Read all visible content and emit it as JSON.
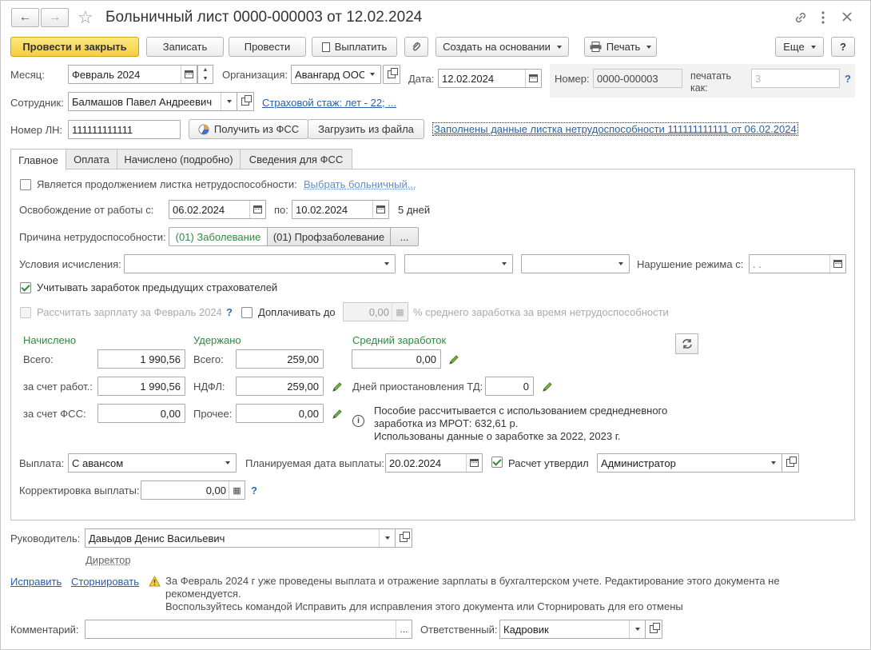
{
  "header": {
    "title": "Больничный лист 0000-000003 от 12.02.2024",
    "link_icon": "link-icon",
    "menu_icon": "more-vertical-icon",
    "close_icon": "close-icon"
  },
  "toolbar": {
    "post_close": "Провести и закрыть",
    "save": "Записать",
    "post": "Провести",
    "pay": "Выплатить",
    "create_based": "Создать на основании",
    "print": "Печать",
    "more": "Еще",
    "help": "?"
  },
  "fields": {
    "month_label": "Месяц:",
    "month": "Февраль 2024",
    "org_label": "Организация:",
    "org": "Авангард ООС",
    "date_label": "Дата:",
    "date": "12.02.2024",
    "number_label": "Номер:",
    "number": "0000-000003",
    "print_as_label_1": "печатать",
    "print_as_label_2": "как:",
    "print_as_placeholder": "3",
    "employee_label": "Сотрудник:",
    "employee": "Балмашов Павел Андреевич",
    "insurance_link": "Страховой стаж: лет - 22; ...",
    "ln_label": "Номер ЛН:",
    "ln": "111111111111",
    "get_fss": "Получить из ФСС",
    "load_file": "Загрузить из файла",
    "filled_link": "Заполнены данные листка нетрудоспособности 111111111111 от 06.02.2024"
  },
  "tabs": [
    "Главное",
    "Оплата",
    "Начислено (подробно)",
    "Сведения для ФСС"
  ],
  "main": {
    "continuation_label": "Является продолжением листка нетрудоспособности:",
    "choose_sick_link": "Выбрать больничный...",
    "release_label": "Освобождение от работы с:",
    "release_from": "06.02.2024",
    "release_to_label": "по:",
    "release_to": "10.02.2024",
    "days": "5 дней",
    "reason_label": "Причина нетрудоспособности:",
    "reason_1": "(01) Заболевание",
    "reason_2": "(01) Профзаболевание",
    "reason_more": "...",
    "conditions_label": "Условия исчисления:",
    "violation_label": "Нарушение режима с:",
    "violation_value": " .  .",
    "prev_earnings": "Учитывать заработок предыдущих страхователей",
    "calc_salary": "Рассчитать зарплату за Февраль 2024",
    "topup_label": "Доплачивать до",
    "topup_value": "0,00",
    "topup_suffix": "% среднего заработка за время нетрудоспособности",
    "accrued_header": "Начислено",
    "withheld_header": "Удержано",
    "avg_header": "Средний заработок",
    "total_label": "Всего:",
    "total_accrued": "1 990,56",
    "employer_label": "за счет работ.:",
    "employer": "1 990,56",
    "fss_label": "за счет ФСС:",
    "fss": "0,00",
    "w_total_label": "Всего:",
    "w_total": "259,00",
    "ndfl_label": "НДФЛ:",
    "ndfl": "259,00",
    "other_label": "Прочее:",
    "other": "0,00",
    "avg_value": "0,00",
    "suspension_label": "Дней приостановления ТД:",
    "suspension": "0",
    "info_1": "Пособие рассчитывается с использованием среднедневного",
    "info_2": "заработка из МРОТ: 632,61 р.",
    "info_3": "Использованы данные о заработке за  2022,  2023 г.",
    "payout_label": "Выплата:",
    "payout": "С авансом",
    "planned_label": "Планируемая дата выплаты:",
    "planned": "20.02.2024",
    "approved_label": "Расчет утвердил",
    "approver": "Администратор",
    "correction_label": "Корректировка выплаты:",
    "correction": "0,00"
  },
  "footer": {
    "manager_label": "Руководитель:",
    "manager": "Давыдов Денис Васильевич",
    "manager_pos": "Директор",
    "fix_link": "Исправить",
    "storno_link": "Сторнировать",
    "warning_1": "За Февраль 2024 г уже проведены выплата и отражение зарплаты в бухгалтерском учете. Редактирование этого документа не",
    "warning_2": "рекомендуется.",
    "warning_3": "Воспользуйтесь командой Исправить для исправления этого документа или Сторнировать для его отмены",
    "comment_label": "Комментарий:",
    "comment": "",
    "responsible_label": "Ответственный:",
    "responsible": "Кадровик"
  },
  "colors": {
    "primary_button": "#f5cf3b",
    "link": "#2b5ea7",
    "green_header": "#2e8b3d"
  }
}
